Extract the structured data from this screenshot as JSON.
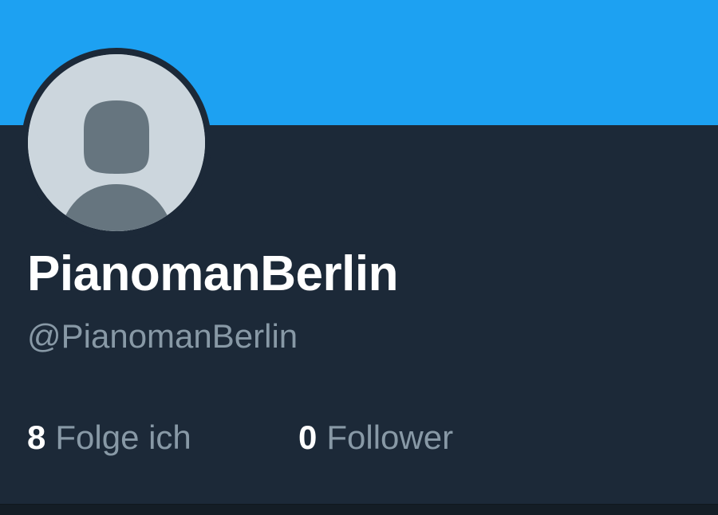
{
  "profile": {
    "display_name": "PianomanBerlin",
    "handle": "@PianomanBerlin",
    "avatar_icon": "default-profile-silhouette-icon"
  },
  "stats": {
    "following": {
      "count": "8",
      "label": "Folge ich"
    },
    "followers": {
      "count": "0",
      "label": "Follower"
    }
  },
  "colors": {
    "banner": "#1da1f2",
    "background": "#1c2938",
    "primary_text": "#ffffff",
    "secondary_text": "#8899a6",
    "avatar_bg": "#ccd6dd",
    "avatar_silhouette": "#66757f"
  }
}
